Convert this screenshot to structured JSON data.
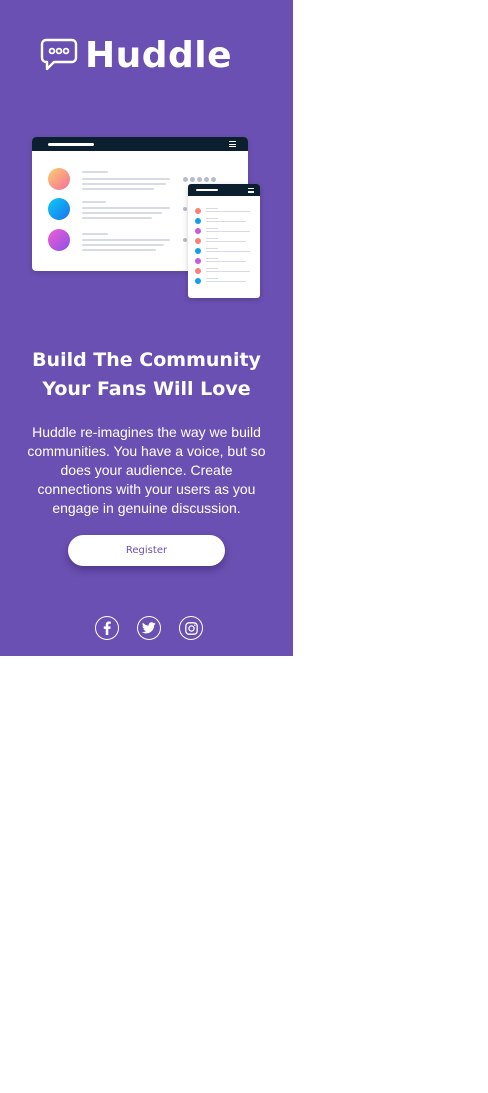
{
  "brand": {
    "name": "Huddle",
    "bg_color": "#6a50b2"
  },
  "hero": {
    "headline_line1": "Build The Community",
    "headline_line2": "Your Fans Will Love",
    "description": "Huddle re-imagines the way we build communities. You have a voice, but so does your audience. Create connections with your users as you engage in genuine discussion.",
    "cta_label": "Register"
  },
  "illustration": {
    "avatar_colors": [
      "gradient-peach",
      "gradient-blue",
      "gradient-purple"
    ],
    "small_list_colors": [
      "#f8817a",
      "#0fa0ea",
      "#c85be0",
      "#f8817a",
      "#0fa0ea",
      "#c85be0",
      "#f8817a",
      "#0fa0ea"
    ]
  },
  "socials": [
    {
      "icon": "facebook-icon"
    },
    {
      "icon": "twitter-icon"
    },
    {
      "icon": "instagram-icon"
    }
  ]
}
